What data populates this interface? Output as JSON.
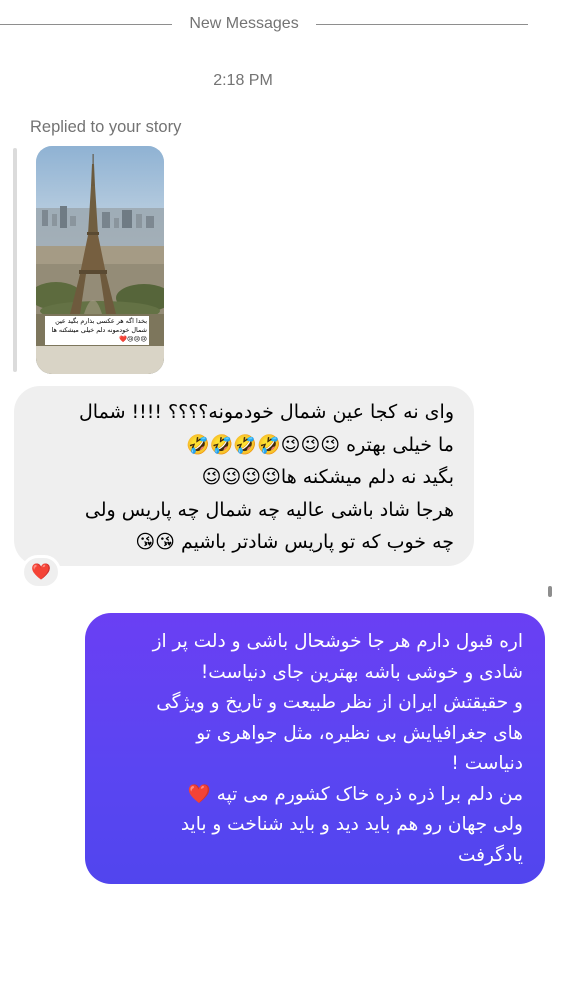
{
  "header": {
    "new_messages_label": "New Messages"
  },
  "timestamp": "2:18 PM",
  "reply_context": {
    "label": "Replied to your story",
    "story_caption": "بخدا اگه هر عکسی بذارم بگید عین شمال خودمونه دلم خیلی میشکنه ها😢😢😢❤️"
  },
  "incoming_message": {
    "text": "وای نه کجا عین شمال خودمونه؟؟؟؟ !!!! شمال\nما خیلی بهتره 😉😉😉🤣🤣🤣🤣\nبگید نه دلم میشکنه ها😉😉😉😉\nهرجا شاد باشی عالیه چه شمال چه پاریس ولی\nچه خوب که تو پاریس شادتر باشیم 😘😘",
    "reaction": "❤️"
  },
  "outgoing_message": {
    "text": "اره قبول دارم هر جا خوشحال باشی و دلت پر از\nشادی و خوشی باشه بهترین جای دنیاست!\nو حقیقتش ایران از نظر طبیعت و تاریخ و ویژگی\nهای جغرافیایش بی نظیره، مثل جواهری تو\nدنیاست !\nمن دلم برا ذره ذره خاک کشورم می تپه ❤️\nولی جهان رو هم باید دید و باید شناخت و باید\nیادگرفت"
  },
  "colors": {
    "incoming_bubble": "#efefef",
    "outgoing_bubble_top": "#6a3ff3",
    "outgoing_bubble_bottom": "#5145ee",
    "meta_text": "#737373"
  },
  "icons": {
    "story_preview": "eiffel-tower-photo",
    "reaction": "heart-emoji"
  }
}
